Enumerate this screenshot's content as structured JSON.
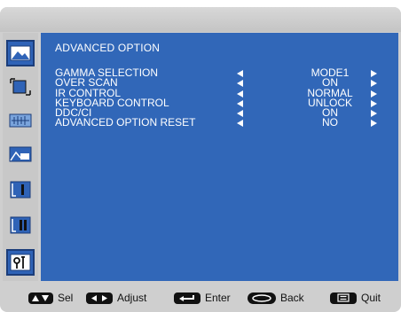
{
  "menu": {
    "title": "ADVANCED OPTION",
    "rows": [
      {
        "label": "GAMMA SELECTION",
        "value": "MODE1"
      },
      {
        "label": "OVER SCAN",
        "value": "ON"
      },
      {
        "label": "IR CONTROL",
        "value": "NORMAL"
      },
      {
        "label": "KEYBOARD CONTROL",
        "value": "UNLOCK"
      },
      {
        "label": "DDC/CI",
        "value": "ON"
      },
      {
        "label": "ADVANCED OPTION RESET",
        "value": "NO"
      }
    ]
  },
  "sidebar": {
    "items": [
      {
        "icon": "picture-icon"
      },
      {
        "icon": "screen-adjust-icon"
      },
      {
        "icon": "audio-icon"
      },
      {
        "icon": "pip-icon"
      },
      {
        "icon": "config1-icon"
      },
      {
        "icon": "config2-icon"
      },
      {
        "icon": "advanced-option-icon"
      }
    ]
  },
  "footer": {
    "sel_label": "Sel",
    "adjust_label": "Adjust",
    "enter_label": "Enter",
    "back_label": "Back",
    "quit_label": "Quit"
  },
  "colors": {
    "panel": "#3167b8",
    "frame": "#cfcfcf"
  }
}
